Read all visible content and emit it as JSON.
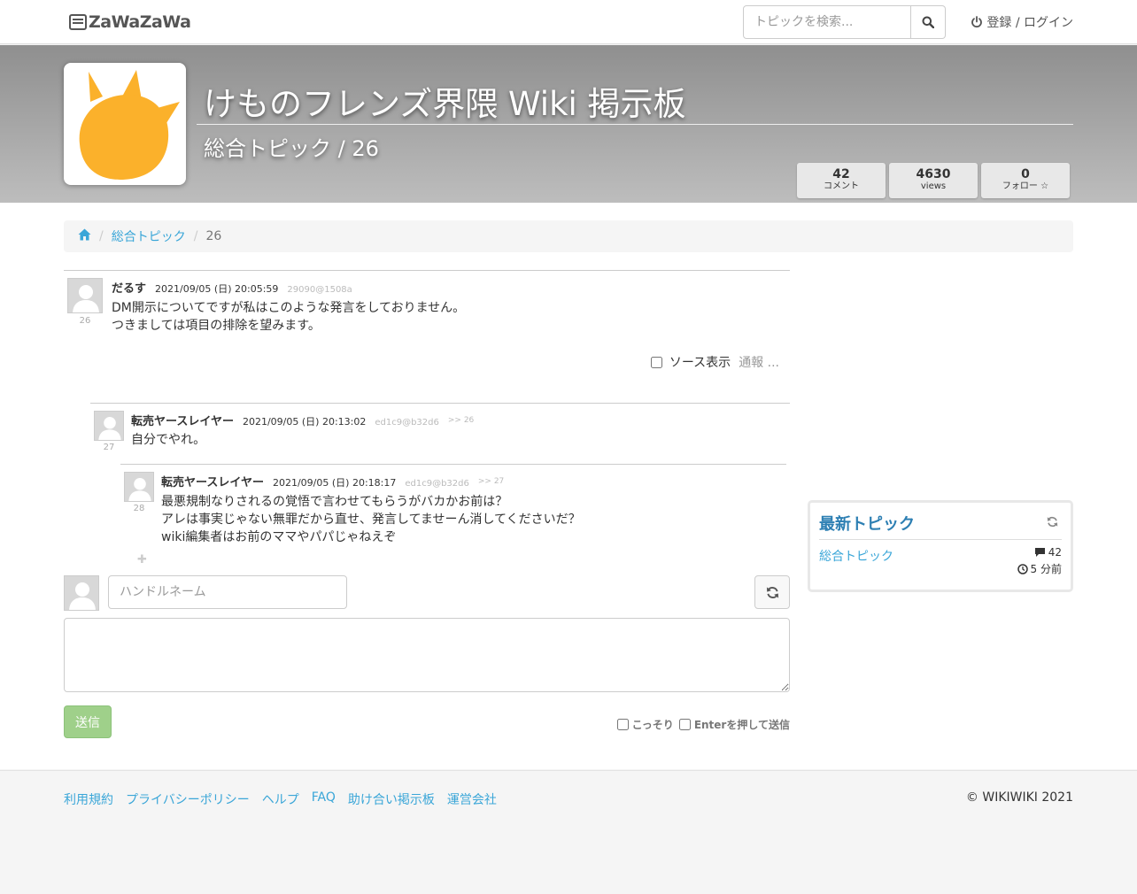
{
  "navbar": {
    "brand": "ZaWaZaWa",
    "search_placeholder": "トピックを検索...",
    "login_label": "登録 / ログイン"
  },
  "banner": {
    "title": "けものフレンズ界隈 Wiki 掲示板",
    "topic_path": "総合トピック / 26",
    "stats": [
      {
        "value": "42",
        "label": "コメント"
      },
      {
        "value": "4630",
        "label": "views"
      },
      {
        "value": "0",
        "label": "フォロー ☆"
      }
    ]
  },
  "breadcrumb": {
    "items": [
      "総合トピック"
    ],
    "current": "26"
  },
  "comments": [
    {
      "number": "26",
      "name": "だるす",
      "date": "2021/09/05 (日) 20:05:59",
      "id": "29090@1508a",
      "reply_to": "",
      "lines": [
        "DM開示についてですが私はこのような発言をしておりません。",
        "つきましては項目の排除を望みます。"
      ]
    },
    {
      "number": "27",
      "name": "転売ヤースレイヤー",
      "date": "2021/09/05 (日) 20:13:02",
      "id": "ed1c9@b32d6",
      "reply_to": ">> 26",
      "lines": [
        "自分でやれ。"
      ]
    },
    {
      "number": "28",
      "name": "転売ヤースレイヤー",
      "date": "2021/09/05 (日) 20:18:17",
      "id": "ed1c9@b32d6",
      "reply_to": ">> 27",
      "lines": [
        "最悪規制なりされるの覚悟で言わせてもらうがバカかお前は？",
        "アレは事実じゃない無罪だから直せ、発言してませーん消してくださいだ？",
        "wiki編集者はお前のママやパパじゃねえぞ"
      ]
    }
  ],
  "comment_tools": {
    "source_label": "ソース表示",
    "report_label": "通報 ..."
  },
  "form": {
    "handle_placeholder": "ハンドルネーム",
    "send_label": "送信",
    "sneaky_label": "こっそり",
    "enter_send_label": "Enterを押して送信"
  },
  "sidebar": {
    "title": "最新トピック",
    "topic_label": "総合トピック",
    "topic_count": "42",
    "topic_time": "5 分前"
  },
  "footer": {
    "links": [
      "利用規約",
      "プライバシーポリシー",
      "ヘルプ",
      "FAQ",
      "助け合い掲示板",
      "運営会社"
    ],
    "copyright": "© WIKIWIKI 2021"
  },
  "colors": {
    "link": "#3aa6d8",
    "sidebar_title": "#2d7fb3",
    "send_button": "#9fd08a",
    "logo_mark": "#fbb12b"
  }
}
